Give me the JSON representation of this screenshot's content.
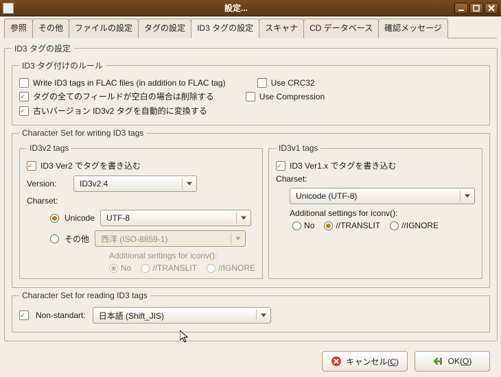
{
  "window": {
    "title": "設定..."
  },
  "tabs": [
    "参照",
    "その他",
    "ファイルの設定",
    "タグの設定",
    "ID3 タグの設定",
    "スキャナ",
    "CD データベース",
    "確認メッセージ"
  ],
  "active_tab_index": 4,
  "id3_settings": {
    "group_label": "ID3 タグの設定",
    "rules": {
      "group_label": "ID3 タグ付けのルール",
      "write_flac": {
        "label": "Write ID3 tags in FLAC files (in addition to FLAC tag)",
        "checked": false
      },
      "use_crc32": {
        "label": "Use CRC32",
        "checked": false
      },
      "strip_empty": {
        "label": "タグの全てのフィールドが空白の場合は削除する",
        "checked": true
      },
      "use_compression": {
        "label": "Use Compression",
        "checked": false
      },
      "auto_convert_old_v2": {
        "label": "古いバージョン ID3v2 タグを自動的に変換する",
        "checked": true
      }
    },
    "write_charset": {
      "group_label": "Character Set for writing ID3 tags",
      "v2": {
        "group_label": "ID3v2 tags",
        "enable": {
          "label": "ID3 Ver2 でタグを書き込む",
          "checked": true
        },
        "version_label": "Version:",
        "version_value": "ID3v2.4",
        "charset_label": "Charset:",
        "charset_mode": "unicode",
        "unicode_label": "Unicode",
        "unicode_value": "UTF-8",
        "other_label": "その他",
        "other_value": "西洋 (ISO-8859-1)",
        "iconv_label": "Additional settings for iconv():",
        "iconv_options": [
          "No",
          "//TRANSLIT",
          "//IGNORE"
        ],
        "iconv_selected": "No"
      },
      "v1": {
        "group_label": "ID3v1 tags",
        "enable": {
          "label": "ID3 Ver1.x でタグを書き込む",
          "checked": true
        },
        "charset_label": "Charset:",
        "charset_value": "Unicode (UTF-8)",
        "iconv_label": "Additional settings for iconv():",
        "iconv_options": [
          "No",
          "//TRANSLIT",
          "//IGNORE"
        ],
        "iconv_selected": "//TRANSLIT"
      }
    },
    "read_charset": {
      "group_label": "Character Set for reading ID3 tags",
      "nonstandard": {
        "label": "Non-standart:",
        "checked": true
      },
      "value": "日本語 (Shift_JIS)"
    }
  },
  "buttons": {
    "cancel": "キャンセル(C)",
    "ok": "OK(O)"
  }
}
